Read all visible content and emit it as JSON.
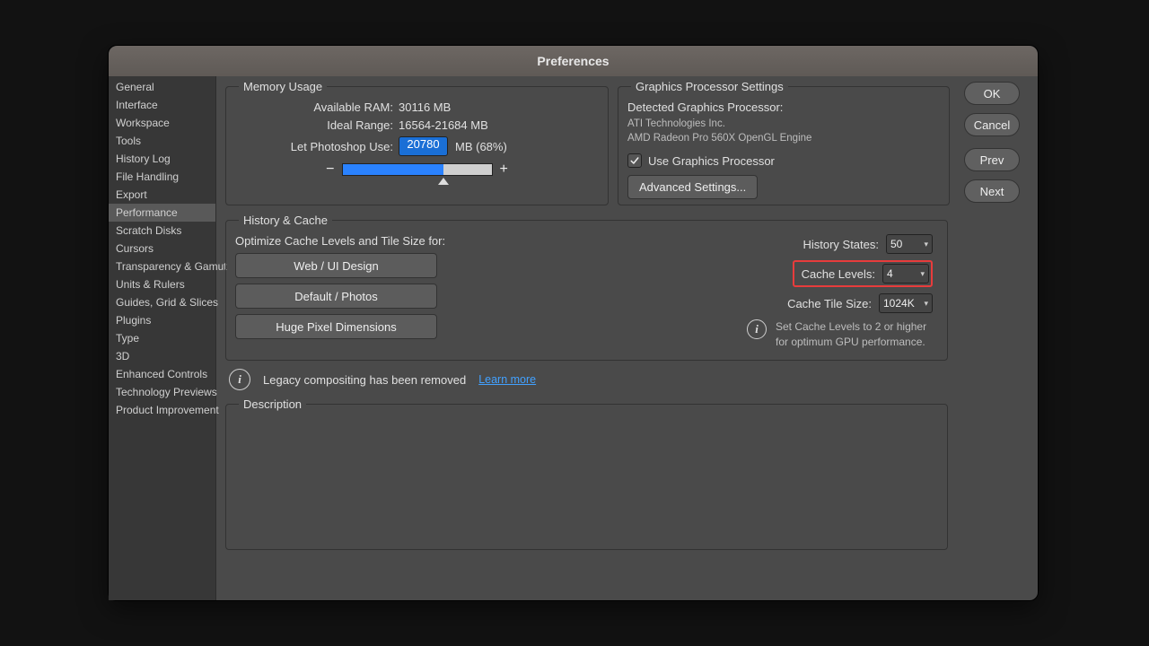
{
  "window": {
    "title": "Preferences"
  },
  "sidebar": {
    "items": [
      "General",
      "Interface",
      "Workspace",
      "Tools",
      "History Log",
      "File Handling",
      "Export",
      "Performance",
      "Scratch Disks",
      "Cursors",
      "Transparency & Gamut",
      "Units & Rulers",
      "Guides, Grid & Slices",
      "Plugins",
      "Type",
      "3D",
      "Enhanced Controls",
      "Technology Previews",
      "Product Improvement"
    ],
    "active_index": 7
  },
  "buttons": {
    "ok": "OK",
    "cancel": "Cancel",
    "prev": "Prev",
    "next": "Next"
  },
  "memory": {
    "legend": "Memory Usage",
    "available_label": "Available RAM:",
    "available_value": "30116 MB",
    "ideal_label": "Ideal Range:",
    "ideal_value": "16564-21684 MB",
    "use_label": "Let Photoshop Use:",
    "use_value": "20780",
    "use_suffix": "MB (68%)",
    "minus": "−",
    "plus": "+"
  },
  "gpu": {
    "legend": "Graphics Processor Settings",
    "detected_label": "Detected Graphics Processor:",
    "vendor": "ATI Technologies Inc.",
    "model": "AMD Radeon Pro 560X OpenGL Engine",
    "use_gpu_label": "Use Graphics Processor",
    "advanced_label": "Advanced Settings..."
  },
  "history": {
    "legend": "History & Cache",
    "optimize_label": "Optimize Cache Levels and Tile Size for:",
    "presets": [
      "Web / UI Design",
      "Default / Photos",
      "Huge Pixel Dimensions"
    ],
    "history_states_label": "History States:",
    "history_states_value": "50",
    "cache_levels_label": "Cache Levels:",
    "cache_levels_value": "4",
    "cache_tile_label": "Cache Tile Size:",
    "cache_tile_value": "1024K",
    "info_text": "Set Cache Levels to 2 or higher for optimum GPU performance."
  },
  "legacy": {
    "text": "Legacy compositing has been removed",
    "link": "Learn more"
  },
  "description": {
    "legend": "Description"
  }
}
